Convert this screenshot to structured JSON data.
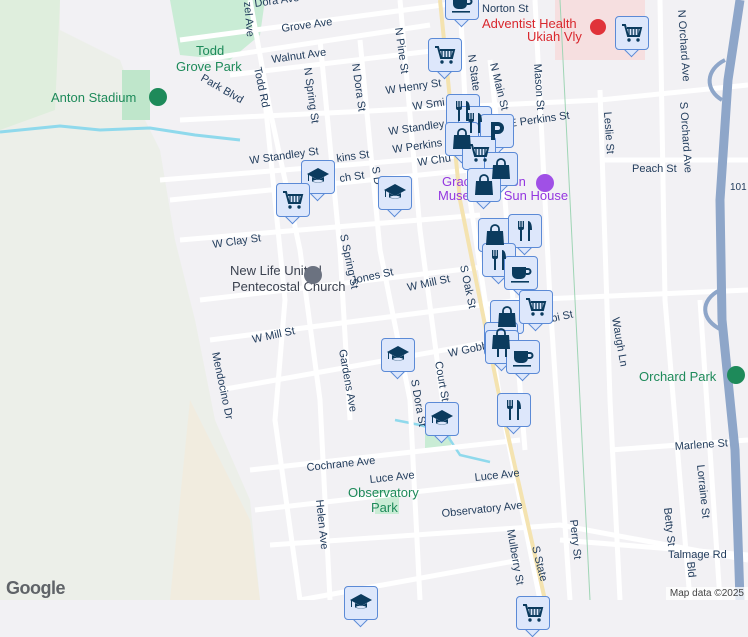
{
  "streets": {
    "dora_ave": "Dora Ave",
    "norton": "Norton St",
    "grove": "Grove Ave",
    "hazel": "zel Ave",
    "walnut": "Walnut Ave",
    "park_blvd": "Park Blvd",
    "todd_rd": "Todd Rd",
    "n_spring": "N Spring St",
    "n_dora": "N Dora St",
    "n_pine": "N Pine St",
    "w_henry": "W Henry St",
    "w_smith": "W Smi",
    "n_state": "N State",
    "n_main": "N Main St",
    "mason": "Mason St",
    "w_standley_e": "W Standley",
    "w_standley": "W Standley St",
    "w_perkins": "W Perkins",
    "e_perkins": "E Perkins St",
    "perkins_w": "kins St",
    "church": "ch St",
    "w_church": "W Chu",
    "s_dora_n": "S D",
    "w_clay": "W Clay St",
    "s_spring": "S Spring St",
    "jones": "Jones St",
    "w_mill": "W Mill St",
    "s_oak": "S Oak St",
    "w_mill_w": "W Mill St",
    "w_gobbi": "W Gobb",
    "gobbi_e": "bi St",
    "gardens": "Gardens Ave",
    "s_dora": "S Dora St",
    "court": "Court St",
    "mendocino": "Mendocino Dr",
    "cochrane": "Cochrane Ave",
    "luce": "Luce Ave",
    "luce_e": "Luce Ave",
    "observatory": "Observatory Ave",
    "helen": "Helen Ave",
    "mulberry": "Mulberry St",
    "s_state": "S State",
    "perry": "Perry St",
    "leslie": "Leslie St",
    "s_orchard": "S Orchard Ave",
    "n_orchard": "N Orchard Ave",
    "peach": "Peach St",
    "waugh": "Waugh Ln",
    "marlene": "Marlene St",
    "lorraine": "Lorraine St",
    "betty": "Betty St",
    "talmage": "Talmage Rd",
    "hwy": "101",
    "bld": "Bld"
  },
  "places": {
    "todd_grove_1": "Todd",
    "todd_grove_2": "Grove Park",
    "anton": "Anton Stadium",
    "church_1": "New Life United",
    "church_2": "Pentecostal Church",
    "hospital_1": "Adventist Health",
    "hospital_2": "Ukiah Vly",
    "museum_1": "Grace Hudson",
    "museum_2": "Museum & Sun House",
    "orchard_park": "Orchard Park",
    "observatory_1": "Observatory",
    "observatory_2": "Park"
  },
  "markers": [
    {
      "type": "cup"
    },
    {
      "type": "cart"
    },
    {
      "type": "cart"
    },
    {
      "type": "fork"
    },
    {
      "type": "fork"
    },
    {
      "type": "parking"
    },
    {
      "type": "bag"
    },
    {
      "type": "cart"
    },
    {
      "type": "bag"
    },
    {
      "type": "bag"
    },
    {
      "type": "grad"
    },
    {
      "type": "cart"
    },
    {
      "type": "grad"
    },
    {
      "type": "bag"
    },
    {
      "type": "fork"
    },
    {
      "type": "fork"
    },
    {
      "type": "cup"
    },
    {
      "type": "bag"
    },
    {
      "type": "cart"
    },
    {
      "type": "bag"
    },
    {
      "type": "grad"
    },
    {
      "type": "fork"
    },
    {
      "type": "cup"
    },
    {
      "type": "fork"
    },
    {
      "type": "grad"
    },
    {
      "type": "grad"
    },
    {
      "type": "cart"
    }
  ],
  "footer": {
    "logo": "Google",
    "attribution": "Map data ©2025"
  },
  "colors": {
    "marker_bg": "#dde7fb",
    "marker_border": "#5b8ad6",
    "icon": "#0b3b5e",
    "park": "#c9ecd5",
    "freeway": "#8ea6c9"
  }
}
